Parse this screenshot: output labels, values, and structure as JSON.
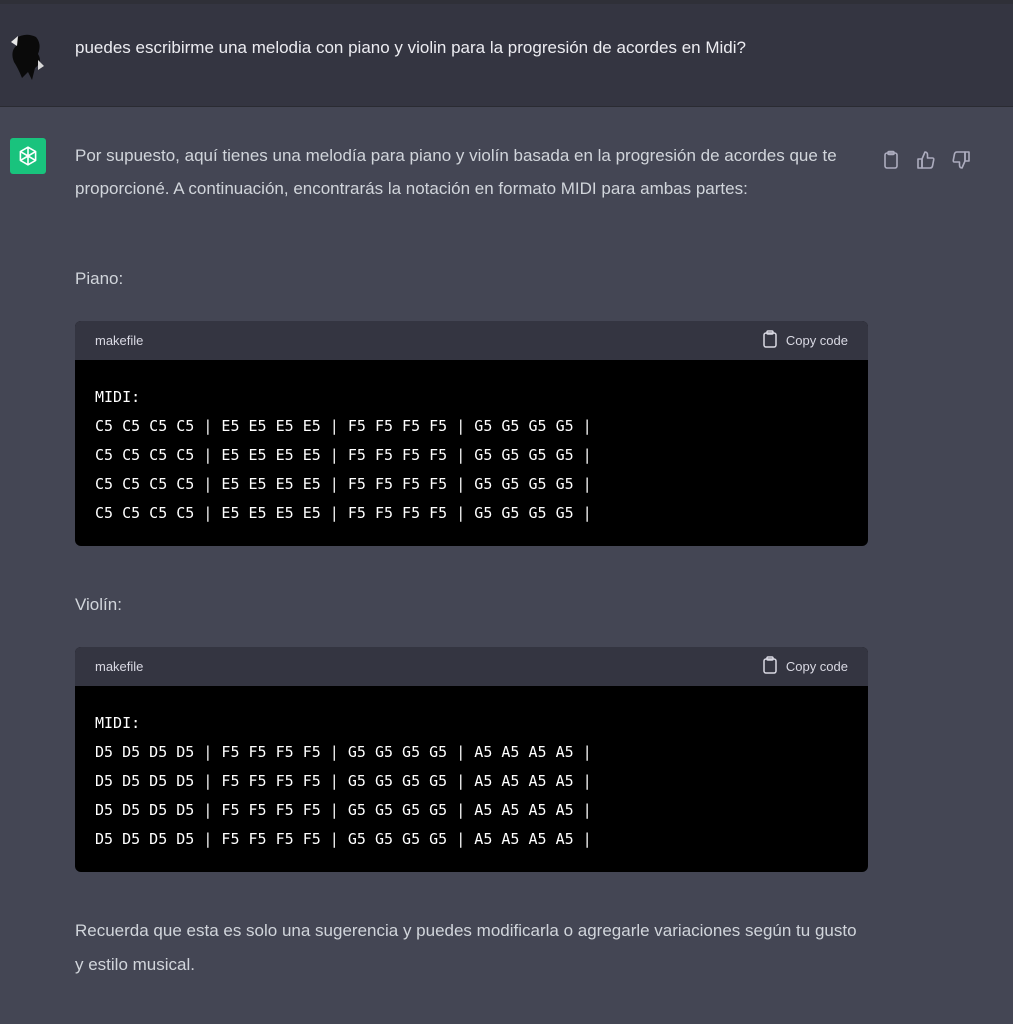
{
  "user_message": "puedes escribirme una melodia con piano y violin para la progresión de acordes en Midi?",
  "assistant": {
    "intro": "Por supuesto, aquí tienes una melodía para piano y violín basada en la progresión de acordes que te proporcioné. A continuación, encontrarás la notación en formato MIDI para ambas partes:",
    "piano_label": "Piano:",
    "violin_label": "Violín:",
    "outro": "Recuerda que esta es solo una sugerencia y puedes modificarla o agregarle variaciones según tu gusto y estilo musical.",
    "code_blocks": [
      {
        "language": "makefile",
        "copy_label": "Copy code",
        "lines": [
          "MIDI:",
          "C5 C5 C5 C5 | E5 E5 E5 E5 | F5 F5 F5 F5 | G5 G5 G5 G5 |",
          "C5 C5 C5 C5 | E5 E5 E5 E5 | F5 F5 F5 F5 | G5 G5 G5 G5 |",
          "C5 C5 C5 C5 | E5 E5 E5 E5 | F5 F5 F5 F5 | G5 G5 G5 G5 |",
          "C5 C5 C5 C5 | E5 E5 E5 E5 | F5 F5 F5 F5 | G5 G5 G5 G5 |"
        ]
      },
      {
        "language": "makefile",
        "copy_label": "Copy code",
        "lines": [
          "MIDI:",
          "D5 D5 D5 D5 | F5 F5 F5 F5 | G5 G5 G5 G5 | A5 A5 A5 A5 |",
          "D5 D5 D5 D5 | F5 F5 F5 F5 | G5 G5 G5 G5 | A5 A5 A5 A5 |",
          "D5 D5 D5 D5 | F5 F5 F5 F5 | G5 G5 G5 G5 | A5 A5 A5 A5 |",
          "D5 D5 D5 D5 | F5 F5 F5 F5 | G5 G5 G5 G5 | A5 A5 A5 A5 |"
        ]
      }
    ]
  },
  "icons": {
    "assistant_avatar": "openai-logo-icon",
    "actions": [
      "clipboard-icon",
      "thumbs-up-icon",
      "thumbs-down-icon"
    ]
  },
  "colors": {
    "assistant_bg": "#444654",
    "user_bg": "#343541",
    "avatar_green": "#19c37d",
    "code_bg": "#000000"
  }
}
